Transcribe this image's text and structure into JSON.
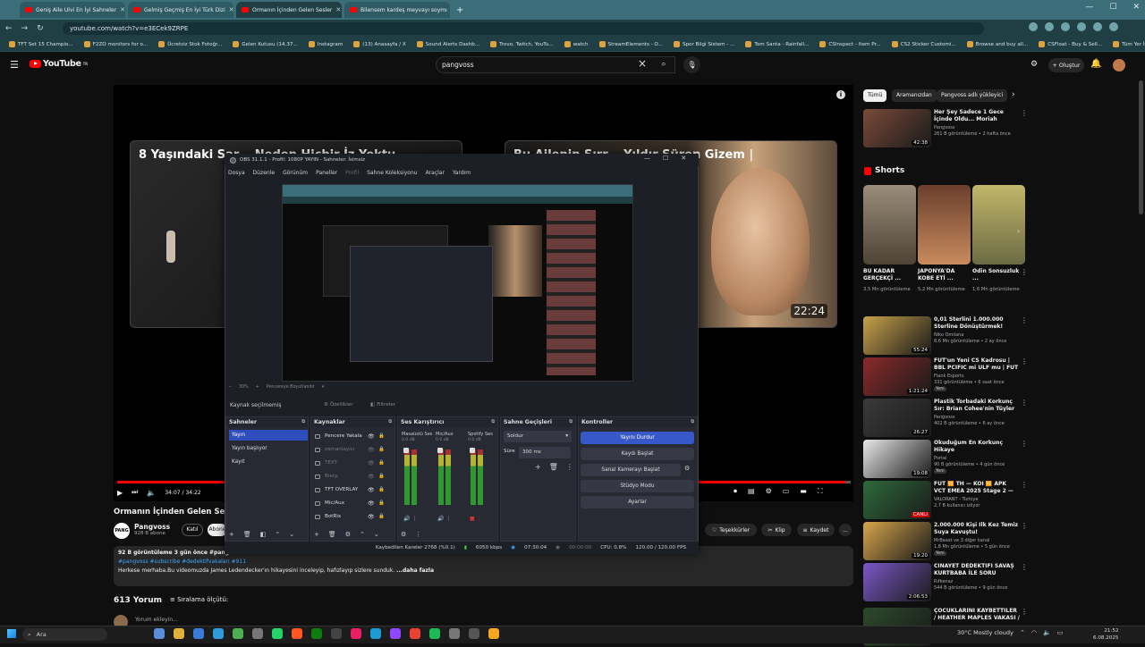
{
  "browser": {
    "tabs": [
      "Geniş Aile Ulvi En İyi Sahneler",
      "Gelmiş Geçmiş En İyi Türk Dizi",
      "Ormanın İçinden Gelen Sesler",
      "Bilensem kardeş meyvayı soymı"
    ],
    "url": "youtube.com/watch?v=e3ECek9ZRPE",
    "bookmarks": [
      "TFT Set 15 Champio...",
      "F2ZO monitors for o...",
      "Ücretsiz Stok Fotoğr...",
      "Gelen Kutusu (14.37...",
      "Instagram",
      "(13) Anasayfa / X",
      "Sound Alerts Dashb...",
      "Trovo, Twitch, YouTu...",
      "watch",
      "StreamElements - O...",
      "Spor Bilgi Sistem - ...",
      "Tom Santa - Rainfall...",
      "CSInspect - Item Pr...",
      "CS2 Sticker Customi...",
      "Browse and buy all...",
      "CSFloat - Buy & Sell...",
      "Tüm Yer İşaretleri"
    ]
  },
  "yt": {
    "logo": "YouTube",
    "logo_sup": "TR",
    "search_value": "pangvoss",
    "create_label": "Oluştur"
  },
  "player": {
    "card1_title": "8 Yaşındaki Sar... Neden Hiçbir İz Yoktu",
    "card2_title": "Bu Ailenin Sırr... Yıldır Süren Gizem |",
    "card2_duration": "22:24",
    "time": "34:07 / 34:22",
    "progress": 0.993
  },
  "video": {
    "title": "Ormanın İçinden Gelen Sesler...",
    "channel_initials": "PANG",
    "channel": "Pangvoss",
    "subs": "928 B abone",
    "join": "Katıl",
    "subscribe": "Abone ol",
    "actions": {
      "thanks": "Teşekkürler",
      "clip": "Klip",
      "save": "Kaydet"
    },
    "desc_stats": "92 B görüntüleme  3 gün önce  #pangvoss",
    "desc_tags": "#pangvoss  #subscribe #dedektifvakaları #911",
    "desc_text": "Herkese merhaba.Bu videomuzda James Ledendecker'ın hikayesini inceleyip, hafızlayıp sizlere sunduk.",
    "desc_more": "...daha fazla",
    "comments": "613 Yorum",
    "sort": "Sıralama ölçütü:",
    "comment_placeholder": "Yorum ekleyin..."
  },
  "chips": [
    "Tümü",
    "Aramanızdan",
    "Pangvoss adlı yükleyici"
  ],
  "shorts_label": "Shorts",
  "shorts": [
    {
      "title": "BU KADAR GERÇEKÇİ ...",
      "views": "3,5 Mn görüntüleme"
    },
    {
      "title": "JAPONYA'DA KOBE ETİ ...",
      "views": "5,2 Mn görüntüleme"
    },
    {
      "title": "Odin Sonsuzluk ...",
      "views": "1,6 Mn görüntüleme"
    }
  ],
  "related": [
    {
      "title": "Her Şey Sadece 1 Gece İçinde Oldu... Moriah Wilson'a Ne Oldu?",
      "channel": "Pangvoss",
      "meta": "261 B görüntüleme • 2 hafta önce",
      "dur": "42:38",
      "badge": ""
    },
    {
      "title": "0,01 Sterlini 1.000.000 Sterline Dönüştürmek!",
      "channel": "Niko Omilana",
      "meta": "8,6 Mn görüntüleme • 2 ay önce",
      "dur": "55:24",
      "badge": ""
    },
    {
      "title": "FUT'un Yeni CS Kadrosu | BBL PCIFIC mi ULF mu | FUT ve BB...",
      "channel": "Flank Esports",
      "meta": "331 görüntüleme • 6 saat önce",
      "dur": "1:21:24",
      "badge": "Yeni"
    },
    {
      "title": "Plastik Torbadaki Korkunç Sır: Brian Cohee'nin Tüyler Ürperte...",
      "channel": "Pangvoss",
      "meta": "402 B görüntüleme • 6 ay önce",
      "dur": "26:27",
      "badge": ""
    },
    {
      "title": "Okuduğum En Korkunç Hikaye",
      "channel": "Portal",
      "meta": "90 B görüntüleme • 4 gün önce",
      "dur": "19:08",
      "badge": "Yeni"
    },
    {
      "title": "FUT 🆚 TH — KOI 🆚 APK VCT EMEA 2025 Stage 2 — 4. Hafta...",
      "channel": "VALORANT - Türkiye",
      "meta": "2,7 B kullanıcı izliyor",
      "dur": "CANLI",
      "badge": ""
    },
    {
      "title": "2.000.000 Kişi İlk Kez Temiz Suya Kavuştu!",
      "channel": "MrBeast ve 3 diğer kanal",
      "meta": "1,8 Mn görüntüleme • 5 gün önce",
      "dur": "19:20",
      "badge": "Yeni"
    },
    {
      "title": "CİNAYET DEDEKTİFİ SAVAŞ KURTBABA İLE SORU CEVAP!",
      "channel": "Rıfkenaz",
      "meta": "544 B görüntüleme • 9 gün önce",
      "dur": "2:06:53",
      "badge": ""
    },
    {
      "title": "ÇOCUKLARINI KAYBETTİLER / HEATHER MAPLES VAKASI / ...",
      "channel": "",
      "meta": "",
      "dur": "",
      "badge": ""
    }
  ],
  "obs": {
    "title": "OBS 31.1.1 - Profil: 1080P YAYIN - Sahneler: İsimsiz",
    "menu": [
      "Dosya",
      "Düzenle",
      "Görünüm",
      "Paneller",
      "Profil",
      "Sahne Koleksiyonu",
      "Araçlar",
      "Yardım"
    ],
    "zoom": "30%",
    "fit": "Pencereye Boyutlandır",
    "no_source": "Kaynak seçilmemiş",
    "properties": "Özellikler",
    "filters": "Filtreler",
    "scenes_h": "Sahneler",
    "scenes": [
      "Yayın",
      "Yayın başlıyor",
      "Kayıt"
    ],
    "sources_h": "Kaynaklar",
    "sources": [
      "Pencere Yakala",
      "zamanlayıcı",
      "TEXT",
      "Bierp",
      "TFT OVERLAY",
      "Mic/Aux",
      "BotRix"
    ],
    "mixer_h": "Ses Karıştırıcı",
    "mixer": [
      {
        "name": "Masaüstü Ses",
        "db": "0.0 dB"
      },
      {
        "name": "Mic/Aux",
        "db": "0.0 dB"
      },
      {
        "name": "Spotify Ses",
        "db": "0.0 dB"
      }
    ],
    "trans_h": "Sahne Geçişleri",
    "trans": "Soldur",
    "dur_label": "Süre",
    "dur_value": "300 ms",
    "ctrl_h": "Kontroller",
    "buttons": [
      "Yayını Durdur",
      "Kaydı Başlat",
      "Sanal Kamerayı Başlat",
      "Stüdyo Modu",
      "Ayarlar"
    ],
    "status": {
      "frames": "Kaybedilen Kareler 2768 (%0.1)",
      "kbps": "6050 kbps",
      "live": "07:30:04",
      "rec": "00:00:00",
      "cpu": "CPU: 0.8%",
      "fps": "120.00 / 120.00 FPS"
    }
  },
  "taskbar": {
    "search": "Ara",
    "weather": "30°C  Mostly cloudy",
    "time": "21:52",
    "date": "6.08.2025"
  }
}
